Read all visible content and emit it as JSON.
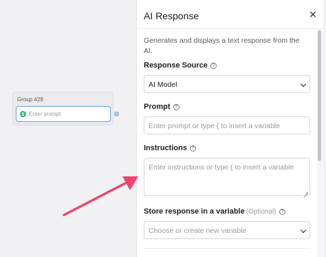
{
  "canvas": {
    "group_title": "Group #29",
    "group_input_placeholder": "Enter prompt"
  },
  "panel": {
    "title": "AI Response",
    "close_glyph": "✕",
    "description": "Generates and displays a text response from the AI.",
    "response_source": {
      "label": "Response Source",
      "value": "AI Model"
    },
    "prompt": {
      "label": "Prompt",
      "placeholder": "Enter prompt or type { to insert a variable"
    },
    "instructions": {
      "label": "Instructions",
      "placeholder": "Enter instructions or type { to insert a variable"
    },
    "store": {
      "label": "Store response in a variable",
      "optional": "(Optional)",
      "placeholder": "Choose or create new variable"
    },
    "help_glyph": "?"
  },
  "colors": {
    "arrow": "#f0446b",
    "focus_border": "#6fa6d8"
  },
  "icons": [
    "help-icon",
    "chevron-down-icon",
    "close-icon",
    "prompt-node-icon"
  ]
}
